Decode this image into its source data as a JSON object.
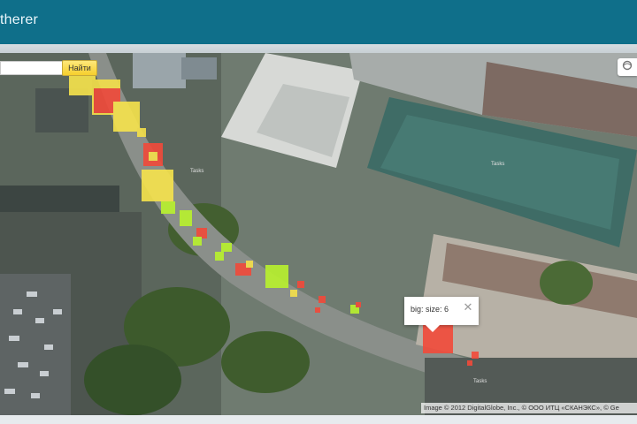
{
  "header": {
    "title": "therer"
  },
  "search": {
    "button_label": "Найти",
    "value": ""
  },
  "balloon": {
    "text": "big: size: 6",
    "close_symbol": "✕"
  },
  "map": {
    "labels": [
      "Tasks",
      "Tasks",
      "Tasks"
    ],
    "copyright": "Image © 2012 DigitalGlobe, Inc., © ООО ИТЦ «СКАНЭКС», © Ge"
  },
  "colors": {
    "header": "#0f6f8a",
    "heat_red": "#f24a3a",
    "heat_yellow": "#f5e04a",
    "heat_lime": "#b9f22e"
  }
}
